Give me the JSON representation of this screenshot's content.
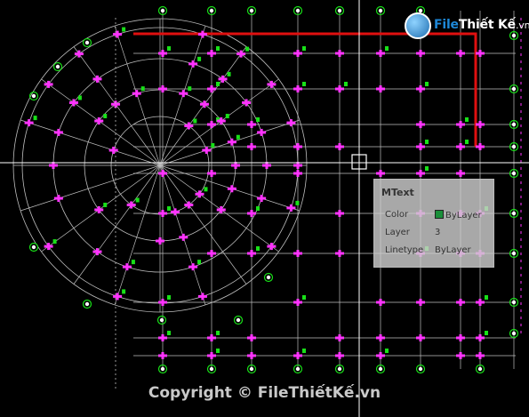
{
  "logo": {
    "part1": "File",
    "part2": "Thiết Kế",
    "tld": ".vn"
  },
  "tooltip": {
    "title": "MText",
    "rows": [
      {
        "label": "Color",
        "value": "ByLayer",
        "swatch": "#1a8f3a"
      },
      {
        "label": "Layer",
        "value": "3"
      },
      {
        "label": "Linetype",
        "value": "ByLayer"
      }
    ]
  },
  "copyright": "Copyright © FileThiếtKế.vn",
  "colors": {
    "background": "#000000",
    "grid_line": "#bfbfbf",
    "beam_red": "#e01010",
    "column_magenta": "#ff33ff",
    "marker_green": "#18e018",
    "crosshair": "#ffffff"
  }
}
